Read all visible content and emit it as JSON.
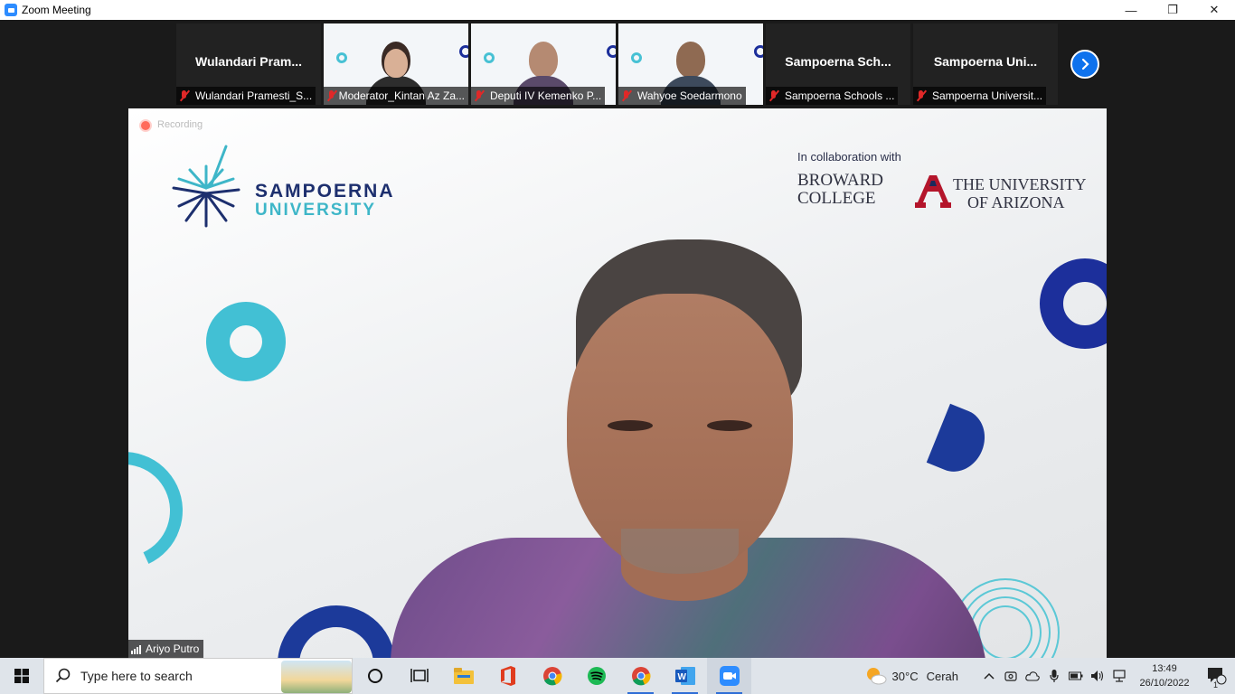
{
  "window": {
    "title": "Zoom Meeting",
    "controls": {
      "minimize": "—",
      "restore": "❐",
      "close": "✕"
    }
  },
  "gallery": {
    "tiles": [
      {
        "display_name": "Wulandari  Pram...",
        "label": "Wulandari Pramesti_S...",
        "video": false
      },
      {
        "display_name": "",
        "label": "Moderator_Kintan Az Za...",
        "video": true
      },
      {
        "display_name": "",
        "label": "Deputi IV Kemenko P...",
        "video": true
      },
      {
        "display_name": "",
        "label": "Wahyoe Soedarmono",
        "video": true
      },
      {
        "display_name": "Sampoerna  Sch...",
        "label": "Sampoerna Schools ...",
        "video": false
      },
      {
        "display_name": "Sampoerna  Uni...",
        "label": "Sampoerna Universit...",
        "video": false
      }
    ],
    "next_icon": "chevron-right-icon"
  },
  "main_video": {
    "recording_label": "Recording",
    "brand_line1": "SAMPOERNA",
    "brand_line2": "UNIVERSITY",
    "collab_text": "In collaboration with",
    "broward_line1": "BROWARD",
    "broward_line2": "COLLEGE",
    "ua_line1": "THE UNIVERSITY",
    "ua_line2": "OF ARIZONA",
    "speaker_name": "Ariyo Putro"
  },
  "taskbar": {
    "search_placeholder": "Type here to search",
    "apps": [
      "cortana-icon",
      "task-view-icon",
      "file-explorer-icon",
      "office-icon",
      "chrome-icon",
      "spotify-icon",
      "chrome-icon",
      "word-icon",
      "zoom-icon"
    ],
    "weather_temp": "30°C",
    "weather_desc": "Cerah",
    "time": "13:49",
    "date": "26/10/2022",
    "notification_count": "1"
  },
  "colors": {
    "zoom_blue": "#0e72ed",
    "brand_navy": "#1d2f6e",
    "brand_teal": "#3eb6c8",
    "muted_red": "#e02828"
  }
}
